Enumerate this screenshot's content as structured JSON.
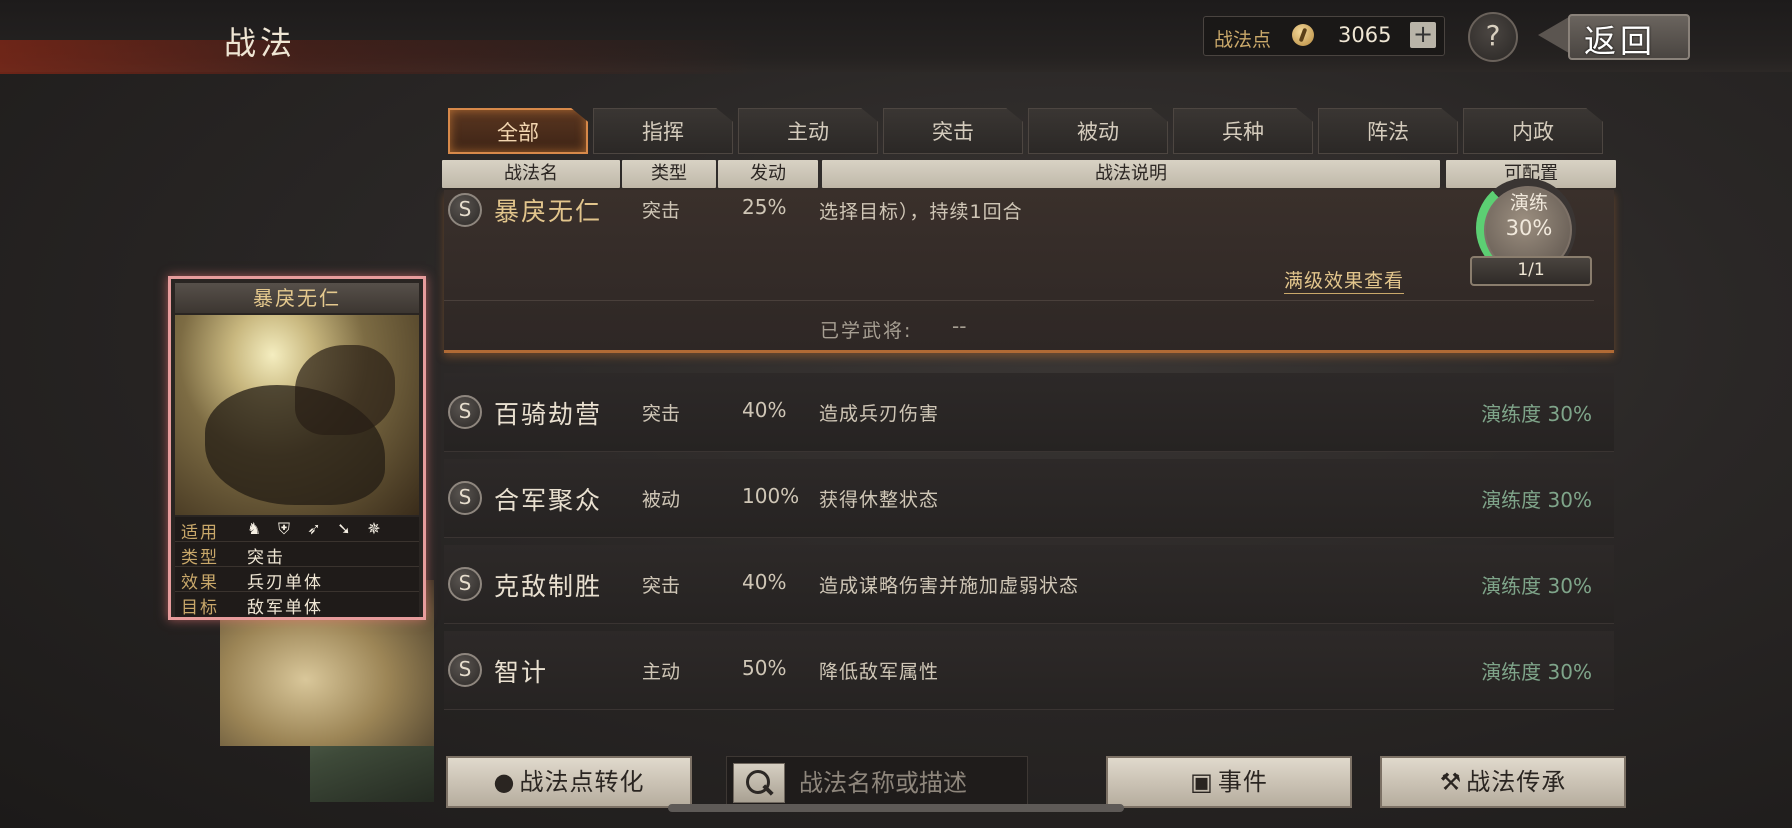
{
  "header": {
    "title": "战法",
    "points_label": "战法点",
    "points_value": "3065",
    "plus_label": "+",
    "help_label": "?",
    "back_label": "返回"
  },
  "tabs": [
    "全部",
    "指挥",
    "主动",
    "突击",
    "被动",
    "兵种",
    "阵法",
    "内政"
  ],
  "columns": {
    "name": "战法名",
    "type": "类型",
    "rate": "发动",
    "desc": "战法说明",
    "config": "可配置"
  },
  "expanded_skill": {
    "grade": "S",
    "name": "暴戾无仁",
    "type": "突击",
    "rate": "25%",
    "desc": "选择目标），持续1回合",
    "full_effect_link": "满级效果查看",
    "learned_label": "已学武将:",
    "learned_value": "--",
    "proficiency_label": "演练",
    "proficiency_value": "30%",
    "proficiency_fraction": 0.3,
    "count": "1/1"
  },
  "skills": [
    {
      "grade": "S",
      "name": "百骑劫营",
      "type": "突击",
      "rate": "40%",
      "desc": "造成兵刃伤害",
      "proficiency": "演练度 30%"
    },
    {
      "grade": "S",
      "name": "合军聚众",
      "type": "被动",
      "rate": "100%",
      "desc": "获得休整状态",
      "proficiency": "演练度 30%"
    },
    {
      "grade": "S",
      "name": "克敌制胜",
      "type": "突击",
      "rate": "40%",
      "desc": "造成谋略伤害并施加虚弱状态",
      "proficiency": "演练度 30%"
    },
    {
      "grade": "S",
      "name": "智计",
      "type": "主动",
      "rate": "50%",
      "desc": "降低敌军属性",
      "proficiency": "演练度 30%"
    }
  ],
  "card": {
    "title": "暴戾无仁",
    "applies_label": "适用",
    "unit_icons": [
      "cavalry-icon",
      "shield-icon",
      "bow-icon",
      "spear-icon",
      "siege-icon"
    ],
    "type_label": "类型",
    "type_value": "突击",
    "effect_label": "效果",
    "effect_value": "兵刃单体",
    "target_label": "目标",
    "target_value": "敌军单体"
  },
  "bottom": {
    "convert_label": "战法点转化",
    "search_placeholder": "战法名称或描述",
    "event_label": "事件",
    "inherit_label": "战法传承"
  },
  "colors": {
    "accent_gold": "#e2c58c",
    "active_tab_border": "#d7894a",
    "proficiency_green": "#7fa58a",
    "card_border": "#e79c9c"
  }
}
